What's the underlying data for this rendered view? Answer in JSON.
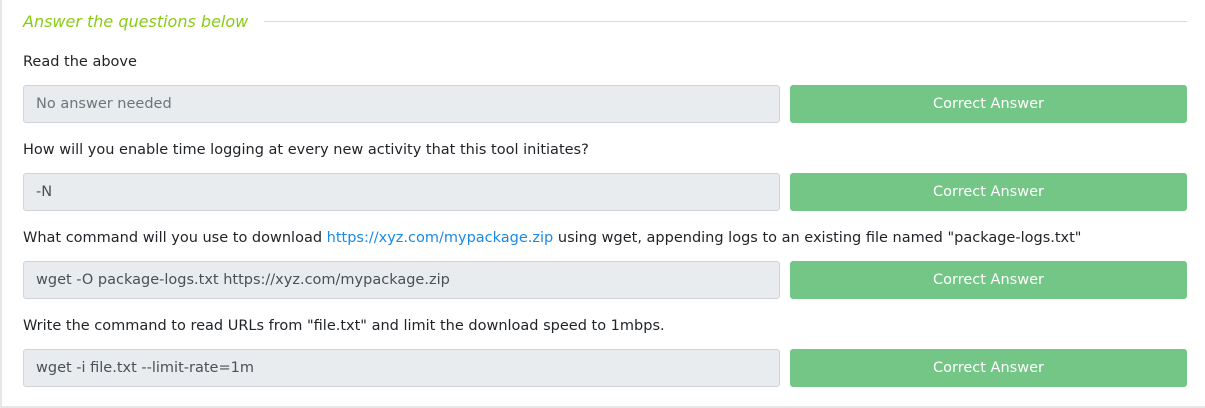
{
  "section": {
    "title": "Answer the questions below"
  },
  "questions": [
    {
      "text": "Read the above",
      "answer_value": "",
      "answer_placeholder": "No answer needed",
      "button_label": "Correct Answer"
    },
    {
      "text": "How will you enable time logging at every new activity that this tool initiates?",
      "answer_value": "-N",
      "answer_placeholder": "",
      "button_label": "Correct Answer"
    },
    {
      "text_before": "What command will you use to download ",
      "link_text": "https://xyz.com/mypackage.zip",
      "text_after": " using wget, appending logs to an existing file named \"package-logs.txt\"",
      "answer_value": "wget -O package-logs.txt https://xyz.com/mypackage.zip",
      "answer_placeholder": "",
      "button_label": "Correct Answer"
    },
    {
      "text": "Write the command to read URLs from \"file.txt\" and limit the download speed to 1mbps.",
      "answer_value": "wget -i file.txt --limit-rate=1m",
      "answer_placeholder": "",
      "button_label": "Correct Answer"
    }
  ],
  "colors": {
    "title": "#88cc14",
    "button_background": "#74c686",
    "input_background": "#e9ecef",
    "link": "#1a8ae6"
  }
}
